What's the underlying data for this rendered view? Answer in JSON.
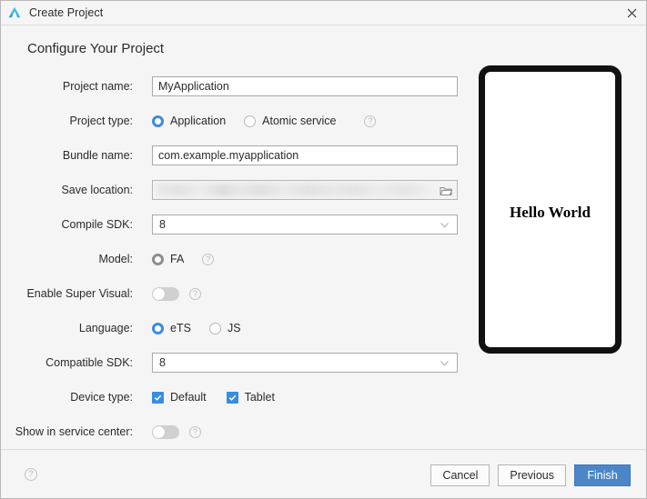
{
  "window": {
    "title": "Create Project",
    "app_icon": "deveco-logo-icon",
    "close_icon": "close-icon"
  },
  "heading": "Configure Your Project",
  "form": {
    "project_name": {
      "label": "Project name:",
      "value": "MyApplication",
      "placeholder": "MyApplication"
    },
    "project_type": {
      "label": "Project type:",
      "options": [
        {
          "label": "Application",
          "selected": true
        },
        {
          "label": "Atomic service",
          "selected": false
        }
      ],
      "help": "?"
    },
    "bundle_name": {
      "label": "Bundle name:",
      "value": "com.example.myapplication",
      "placeholder": "com.example.myapplication"
    },
    "save_location": {
      "label": "Save location:",
      "value": "",
      "redacted": true,
      "browse_icon": "folder-icon"
    },
    "compile_sdk": {
      "label": "Compile SDK:",
      "value": "8",
      "options": [
        "8"
      ],
      "arrow_icon": "chevron-down-icon"
    },
    "model": {
      "label": "Model:",
      "options": [
        {
          "label": "FA",
          "selected": true,
          "disabled": true
        }
      ],
      "help": "?"
    },
    "super_visual": {
      "label": "Enable Super Visual:",
      "state": "off",
      "help": "?"
    },
    "language": {
      "label": "Language:",
      "options": [
        {
          "label": "eTS",
          "selected": true
        },
        {
          "label": "JS",
          "selected": false
        }
      ]
    },
    "compatible_sdk": {
      "label": "Compatible SDK:",
      "value": "8",
      "options": [
        "8"
      ],
      "arrow_icon": "chevron-down-icon"
    },
    "device_type": {
      "label": "Device type:",
      "options": [
        {
          "label": "Default",
          "checked": true
        },
        {
          "label": "Tablet",
          "checked": true
        }
      ]
    },
    "service_center": {
      "label": "Show in service center:",
      "state": "off",
      "help": "?"
    }
  },
  "preview": {
    "text": "Hello World"
  },
  "footer": {
    "help": "?",
    "cancel_label": "Cancel",
    "previous_label": "Previous",
    "finish_label": "Finish"
  },
  "colors": {
    "accent": "#3a8ce0",
    "primary_button": "#4a86c8",
    "dialog_bg": "#f5f5f5",
    "text": "#2b2b2b"
  }
}
